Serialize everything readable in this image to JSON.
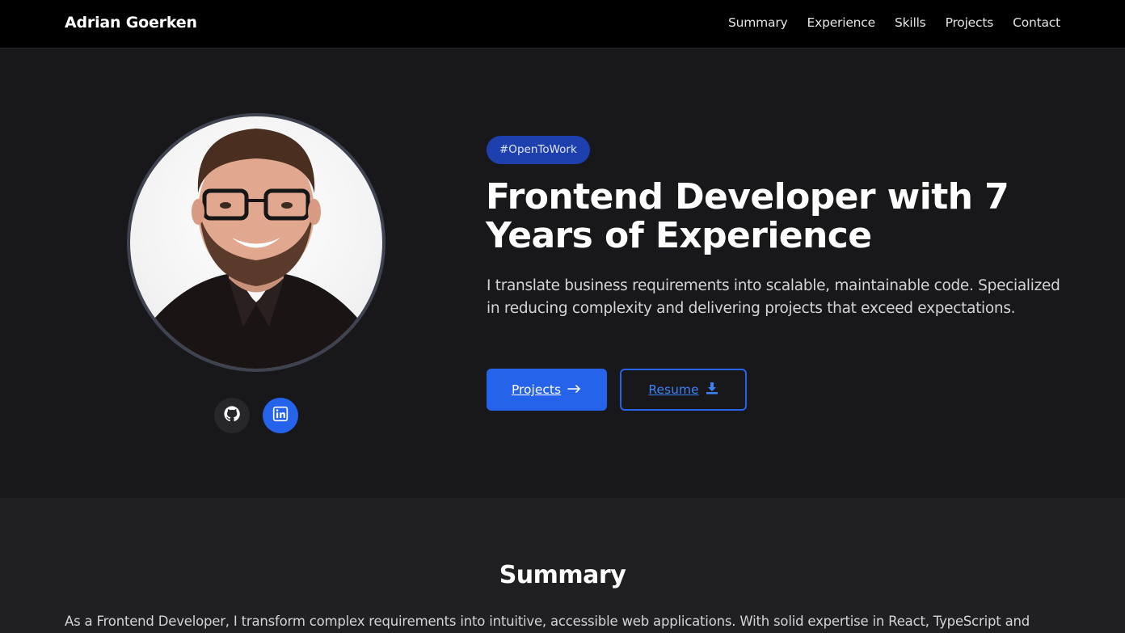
{
  "header": {
    "brand": "Adrian Goerken",
    "nav": [
      "Summary",
      "Experience",
      "Skills",
      "Projects",
      "Contact"
    ]
  },
  "hero": {
    "badge": "#OpenToWork",
    "headline": "Frontend Developer with 7 Years of Experience",
    "lede": "I translate business requirements into scalable, maintainable code. Specialized in reducing complexity and delivering projects that exceed expectations.",
    "primary_button": "Projects",
    "primary_button_icon": "arrow-right-icon",
    "secondary_button": "Resume",
    "secondary_button_icon": "download-icon",
    "socials": [
      "github-icon",
      "linkedin-icon"
    ]
  },
  "summary": {
    "title": "Summary",
    "text": "As a Frontend Developer, I transform complex requirements into intuitive, accessible web applications. With solid expertise in React, TypeScript and"
  },
  "colors": {
    "accent": "#2563eb",
    "badge_bg": "#1e40af",
    "page_bg": "#18181b",
    "header_bg": "#000000"
  }
}
